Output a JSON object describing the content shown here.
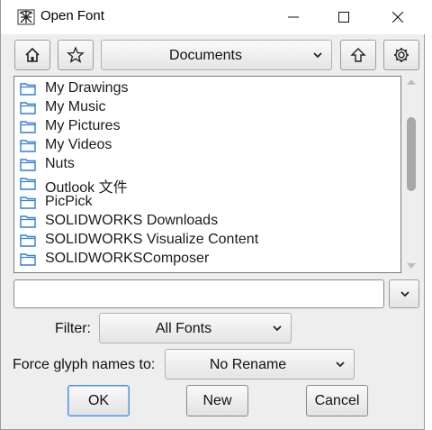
{
  "window": {
    "title": "Open Font",
    "icons": {
      "app": "fontforge-app-icon",
      "minimize": "minimize-icon",
      "maximize": "maximize-icon",
      "close": "close-icon"
    }
  },
  "toolbar": {
    "home_icon": "home-icon",
    "bookmark_icon": "star-icon",
    "directory": "Documents",
    "up_icon": "arrow-up-icon",
    "settings_icon": "gear-icon"
  },
  "files": [
    {
      "name": "My Drawings",
      "icon": "folder-icon"
    },
    {
      "name": "My Music",
      "icon": "folder-icon"
    },
    {
      "name": "My Pictures",
      "icon": "folder-icon"
    },
    {
      "name": "My Videos",
      "icon": "folder-icon"
    },
    {
      "name": "Nuts",
      "icon": "folder-icon"
    },
    {
      "name": "Outlook 文件",
      "icon": "folder-icon"
    },
    {
      "name": "PicPick",
      "icon": "folder-icon"
    },
    {
      "name": "SOLIDWORKS Downloads",
      "icon": "folder-icon"
    },
    {
      "name": "SOLIDWORKS Visualize Content",
      "icon": "folder-icon"
    },
    {
      "name": "SOLIDWORKSComposer",
      "icon": "folder-icon"
    }
  ],
  "filename": {
    "value": "",
    "placeholder": ""
  },
  "filter": {
    "label": "Filter:",
    "value": "All Fonts"
  },
  "glyph_names": {
    "label": "Force glyph names to:",
    "value": "No Rename"
  },
  "buttons": {
    "ok": {
      "mnemonic": "O",
      "rest": "K"
    },
    "new": {
      "mnemonic": "N",
      "rest": "ew"
    },
    "cancel": {
      "mnemonic": "C",
      "rest": "ancel"
    }
  },
  "colors": {
    "window_bg": "#eeeeee",
    "list_bg": "#ffffff",
    "folder": "#2f7fd6",
    "default_button_border": "#4a90e2"
  }
}
